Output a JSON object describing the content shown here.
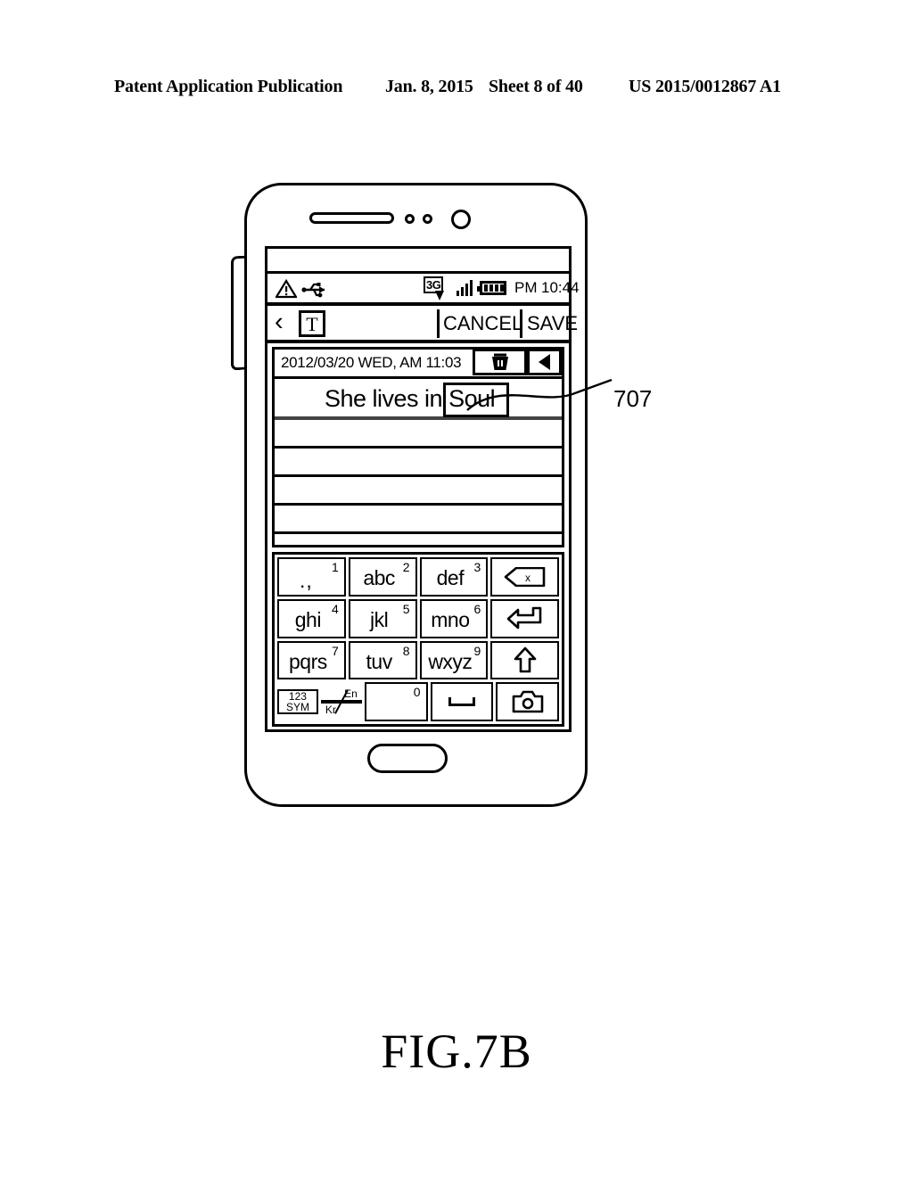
{
  "page_header": {
    "publication": "Patent Application Publication",
    "date": "Jan. 8, 2015",
    "sheet": "Sheet 8 of 40",
    "number": "US 2015/0012867 A1"
  },
  "figure": {
    "caption": "FIG.7B",
    "callout_label": "707"
  },
  "device": {
    "icons": {
      "speaker": "speaker-grille",
      "sensor_left": "proximity-sensor",
      "sensor_right": "light-sensor",
      "front_camera": "front-camera",
      "home_button": "home-button",
      "side_button": "volume-rocker"
    }
  },
  "status_bar": {
    "warning_icon": "warning-triangle-icon",
    "usb_icon": "usb-icon",
    "network": "3G",
    "network_arrow_icon": "data-download-arrow-icon",
    "signal_icon": "signal-bars-icon",
    "signal_bars": 4,
    "battery_icon": "battery-icon",
    "battery_segments": 4,
    "am_pm": "PM",
    "time": "10:44"
  },
  "toolbar": {
    "back_icon": "back-chevron-icon",
    "text_tool_label": "T",
    "cancel_label": "CANCEL",
    "save_label": "SAVE"
  },
  "memo": {
    "date_line": "2012/03/20 WED, AM 11:03",
    "delete_icon": "trash-icon",
    "prev_icon": "previous-triangle-icon",
    "text_prefix": "She lives in",
    "highlighted_word": "Soul",
    "empty_lines": 5
  },
  "keyboard": {
    "rows": [
      [
        {
          "letters": ".,",
          "digit": "1",
          "type": "punct"
        },
        {
          "letters": "abc",
          "digit": "2",
          "type": "letters"
        },
        {
          "letters": "def",
          "digit": "3",
          "type": "letters"
        },
        {
          "icon": "backspace-icon",
          "type": "icon"
        }
      ],
      [
        {
          "letters": "ghi",
          "digit": "4",
          "type": "letters"
        },
        {
          "letters": "jkl",
          "digit": "5",
          "type": "letters"
        },
        {
          "letters": "mno",
          "digit": "6",
          "type": "letters"
        },
        {
          "icon": "enter-icon",
          "type": "icon"
        }
      ],
      [
        {
          "letters": "pqrs",
          "digit": "7",
          "type": "letters"
        },
        {
          "letters": "tuv",
          "digit": "8",
          "type": "letters"
        },
        {
          "letters": "wxyz",
          "digit": "9",
          "type": "letters"
        },
        {
          "icon": "shift-up-arrow-icon",
          "type": "icon"
        }
      ]
    ],
    "bottom_row": {
      "sym_line1": "123",
      "sym_line2": "SYM",
      "lang_kr": "Kr",
      "lang_en": "En",
      "zero_digit": "0",
      "space_icon": "spacebar-icon",
      "camera_icon": "camera-icon"
    }
  }
}
